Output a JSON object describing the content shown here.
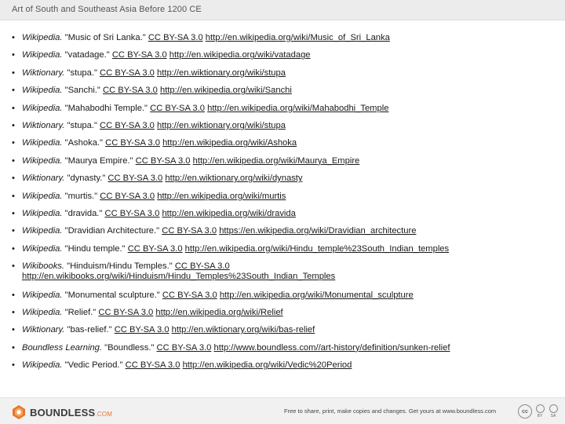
{
  "header": {
    "title": "Art of South and Southeast Asia Before 1200 CE"
  },
  "references": [
    {
      "source": "Wikipedia.",
      "title": "\"Music of Sri Lanka.\"",
      "license": "CC BY-SA 3.0",
      "url": "http://en.wikipedia.org/wiki/Music_of_Sri_Lanka"
    },
    {
      "source": "Wikipedia.",
      "title": "\"vatadage.\"",
      "license": "CC BY-SA 3.0",
      "url": "http://en.wikipedia.org/wiki/vatadage"
    },
    {
      "source": "Wiktionary.",
      "title": "\"stupa.\"",
      "license": "CC BY-SA 3.0",
      "url": "http://en.wiktionary.org/wiki/stupa"
    },
    {
      "source": "Wikipedia.",
      "title": "\"Sanchi.\"",
      "license": "CC BY-SA 3.0",
      "url": "http://en.wikipedia.org/wiki/Sanchi"
    },
    {
      "source": "Wikipedia.",
      "title": "\"Mahabodhi Temple.\"",
      "license": "CC BY-SA 3.0",
      "url": "http://en.wikipedia.org/wiki/Mahabodhi_Temple"
    },
    {
      "source": "Wiktionary.",
      "title": "\"stupa.\"",
      "license": "CC BY-SA 3.0",
      "url": "http://en.wiktionary.org/wiki/stupa"
    },
    {
      "source": "Wikipedia.",
      "title": "\"Ashoka.\"",
      "license": "CC BY-SA 3.0",
      "url": "http://en.wikipedia.org/wiki/Ashoka"
    },
    {
      "source": "Wikipedia.",
      "title": "\"Maurya Empire.\"",
      "license": "CC BY-SA 3.0",
      "url": "http://en.wikipedia.org/wiki/Maurya_Empire"
    },
    {
      "source": "Wiktionary.",
      "title": "\"dynasty.\"",
      "license": "CC BY-SA 3.0",
      "url": "http://en.wiktionary.org/wiki/dynasty"
    },
    {
      "source": "Wikipedia.",
      "title": "\"murtis.\"",
      "license": "CC BY-SA 3.0",
      "url": "http://en.wikipedia.org/wiki/murtis"
    },
    {
      "source": "Wikipedia.",
      "title": "\"dravida.\"",
      "license": "CC BY-SA 3.0",
      "url": "http://en.wikipedia.org/wiki/dravida"
    },
    {
      "source": "Wikipedia.",
      "title": "\"Dravidian Architecture.\"",
      "license": "CC BY-SA 3.0",
      "url": "https://en.wikipedia.org/wiki/Dravidian_architecture"
    },
    {
      "source": "Wikipedia.",
      "title": "\"Hindu temple.\"",
      "license": "CC BY-SA 3.0",
      "url": "http://en.wikipedia.org/wiki/Hindu_temple%23South_Indian_temples"
    },
    {
      "source": "Wikibooks.",
      "title": "\"Hinduism/Hindu Temples.\"",
      "license": "CC BY-SA 3.0",
      "url": "http://en.wikibooks.org/wiki/Hinduism/Hindu_Temples%23South_Indian_Temples",
      "wrap": true
    },
    {
      "source": "Wikipedia.",
      "title": "\"Monumental sculpture.\"",
      "license": "CC BY-SA 3.0",
      "url": "http://en.wikipedia.org/wiki/Monumental_sculpture"
    },
    {
      "source": "Wikipedia.",
      "title": "\"Relief.\"",
      "license": "CC BY-SA 3.0",
      "url": "http://en.wikipedia.org/wiki/Relief"
    },
    {
      "source": "Wiktionary.",
      "title": "\"bas-relief.\"",
      "license": "CC BY-SA 3.0",
      "url": "http://en.wiktionary.org/wiki/bas-relief"
    },
    {
      "source": "Boundless Learning.",
      "title": "\"Boundless.\"",
      "license": "CC BY-SA 3.0",
      "url": "http://www.boundless.com//art-history/definition/sunken-relief"
    },
    {
      "source": "Wikipedia.",
      "title": "\"Vedic Period.\"",
      "license": "CC BY-SA 3.0",
      "url": "http://en.wikipedia.org/wiki/Vedic%20Period"
    }
  ],
  "footer": {
    "logo_text": "BOUNDLESS",
    "logo_suffix": ".COM",
    "logo_icon": "boundless-logo-icon",
    "tagline": "Free to share, print, make copies and changes. Get yours at www.boundless.com",
    "cc_badge": "cc",
    "cc_by": "BY",
    "cc_sa": "SA"
  },
  "colors": {
    "header_bg": "#ececec",
    "footer_bg": "#f1f1f1",
    "logo_accent": "#e8762c"
  }
}
